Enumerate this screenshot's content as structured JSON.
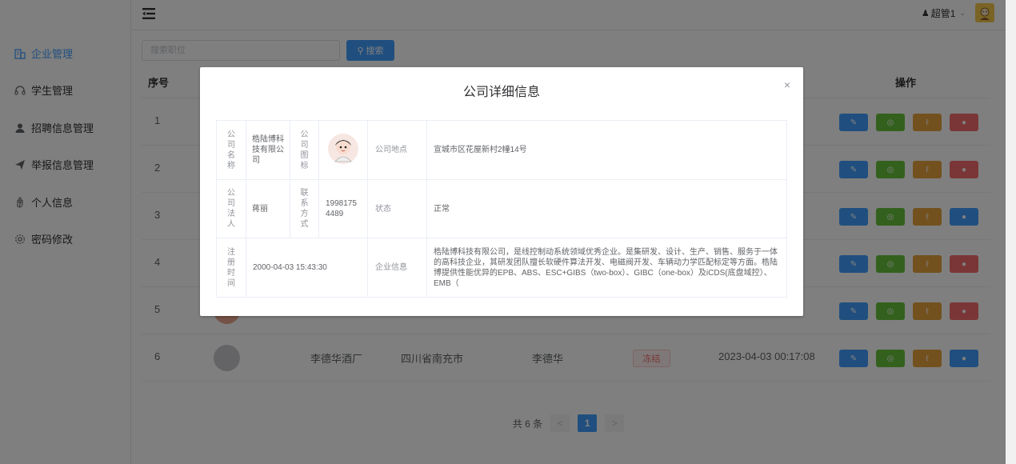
{
  "sidebar": {
    "items": [
      {
        "label": "企业管理",
        "icon": "building-icon",
        "active": true
      },
      {
        "label": "学生管理",
        "icon": "headset-icon"
      },
      {
        "label": "招聘信息管理",
        "icon": "user-icon"
      },
      {
        "label": "举报信息管理",
        "icon": "send-icon"
      },
      {
        "label": "个人信息",
        "icon": "hand-icon"
      },
      {
        "label": "密码修改",
        "icon": "gear-icon"
      }
    ]
  },
  "header": {
    "user_label": "超管1"
  },
  "search": {
    "placeholder": "搜索职位",
    "button_label": "搜索"
  },
  "table": {
    "headers": {
      "index": "序号",
      "actions": "操作"
    },
    "rows": [
      {
        "index": "1"
      },
      {
        "index": "2"
      },
      {
        "index": "3"
      },
      {
        "index": "4"
      },
      {
        "index": "5"
      },
      {
        "index": "6",
        "name": "李德华酒厂",
        "location": "四川省南充市",
        "legal": "李德华",
        "status": "冻结",
        "time": "2023-04-03 00:17:08"
      }
    ]
  },
  "pagination": {
    "total_label": "共 6 条",
    "prev": "<",
    "current": "1",
    "next": ">"
  },
  "dialog": {
    "title": "公司详细信息",
    "close": "×",
    "labels": {
      "company_name": "公司名称",
      "company_logo": "公司图标",
      "location": "公司地点",
      "legal_person": "公司法人",
      "contact": "联系方式",
      "status": "状态",
      "reg_time": "注册时间",
      "info": "企业信息"
    },
    "values": {
      "company_name": "梏陆博科技有限公司",
      "location": "宣城市区花屋新村2幢14号",
      "legal_person": "蒋丽",
      "contact": "19981754489",
      "status": "正常",
      "reg_time": "2000-04-03 15:43:30",
      "info": "梏陆博科技有限公司，是线控制动系统领域优秀企业。是集研发、设计、生产、销售、服务于一体的高科技企业，其研发团队擅长软硬件算法开发、电磁阀开发、车辆动力学匹配标定等方面。梏陆博提供性能优异的EPB、ABS、ESC+GIBS（two-box）、GIBC（one-box）及iCDS(底盘域控）、EMB（"
    }
  }
}
